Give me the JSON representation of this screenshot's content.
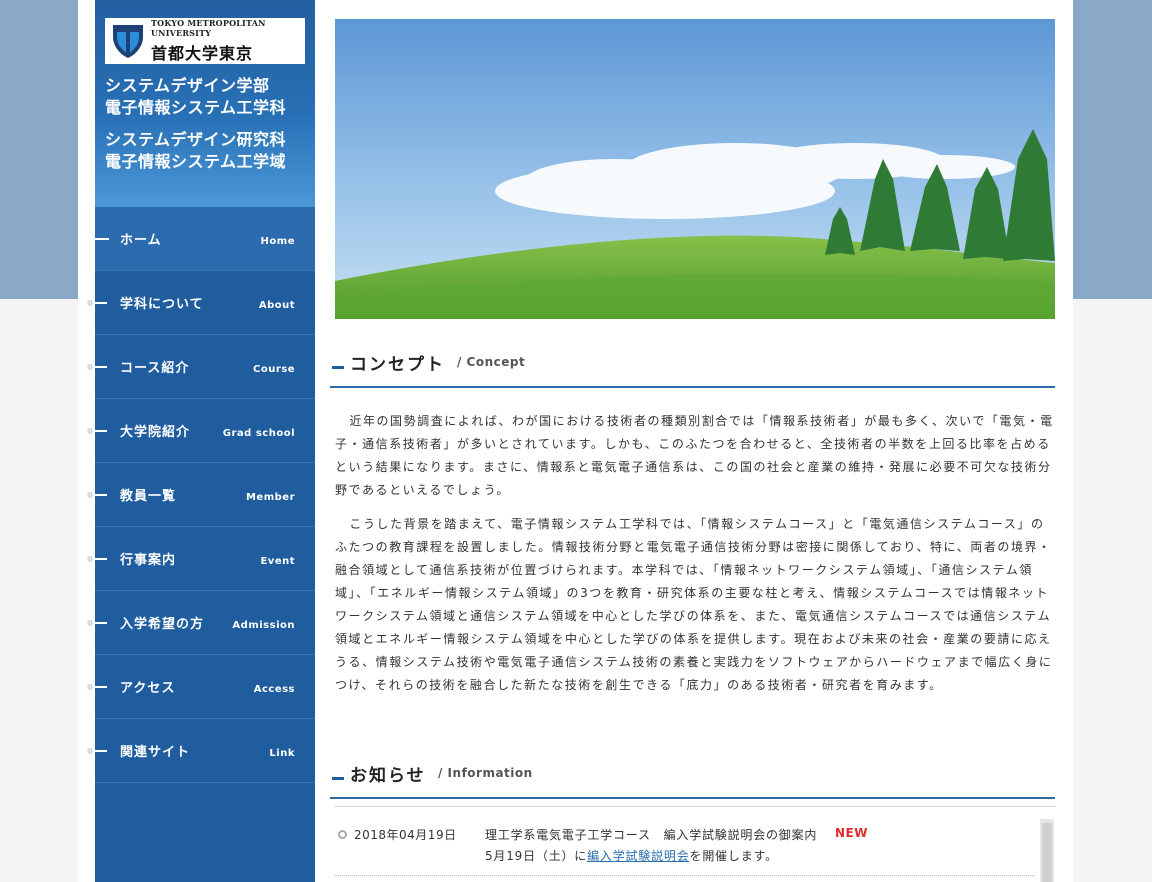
{
  "branding": {
    "university_en": "TOKYO METROPOLITAN UNIVERSITY",
    "university_ja": "首都大学東京",
    "dept_lines": [
      "システムデザイン学部",
      "電子情報システム工学科",
      "システムデザイン研究科",
      "電子情報システム工学域"
    ]
  },
  "nav": {
    "items": [
      {
        "ja": "ホーム",
        "en": "Home"
      },
      {
        "ja": "学科について",
        "en": "About"
      },
      {
        "ja": "コース紹介",
        "en": "Course"
      },
      {
        "ja": "大学院紹介",
        "en": "Grad school"
      },
      {
        "ja": "教員一覧",
        "en": "Member"
      },
      {
        "ja": "行事案内",
        "en": "Event"
      },
      {
        "ja": "入学希望の方",
        "en": "Admission"
      },
      {
        "ja": "アクセス",
        "en": "Access"
      },
      {
        "ja": "関連サイト",
        "en": "Link"
      }
    ]
  },
  "concept": {
    "title_ja": "コンセプト",
    "title_en": "/ Concept",
    "paragraphs": [
      "近年の国勢調査によれば、わが国における技術者の種類別割合では「情報系技術者」が最も多く、次いで「電気・電子・通信系技術者」が多いとされています。しかも、このふたつを合わせると、全技術者の半数を上回る比率を占めるという結果になります。まさに、情報系と電気電子通信系は、この国の社会と産業の維持・発展に必要不可欠な技術分野であるといえるでしょう。",
      "こうした背景を踏まえて、電子情報システム工学科では、「情報システムコース」と「電気通信システムコース」のふたつの教育課程を設置しました。情報技術分野と電気電子通信技術分野は密接に関係しており、特に、両者の境界・融合領域として通信系技術が位置づけられます。本学科では、「情報ネットワークシステム領域」、「通信システム領域」、「エネルギー情報システム領域」の3つを教育・研究体系の主要な柱と考え、情報システムコースでは情報ネットワークシステム領域と通信システム領域を中心とした学びの体系を、また、電気通信システムコースでは通信システム領域とエネルギー情報システム領域を中心とした学びの体系を提供します。現在および未来の社会・産業の要請に応えうる、情報システム技術や電気電子通信システム技術の素養と実践力をソフトウェアからハードウェアまで幅広く身につけ、それらの技術を融合した新たな技術を創生できる「底力」のある技術者・研究者を育みます。"
    ]
  },
  "info": {
    "title_ja": "お知らせ",
    "title_en": "/ Information",
    "news": [
      {
        "date": "2018年04月19日",
        "title": "理工学系電気電子工学コース　編入学試験説明会の御案内",
        "badge": "NEW",
        "sub_prefix": "5月19日（土）に",
        "sub_link": "編入学試験説明会",
        "sub_suffix": "を開催します。"
      }
    ]
  },
  "colors": {
    "sidebar": "#1f5d9e",
    "accent_line": "#2c6aa8",
    "top_band": "#8aa9c8",
    "new_badge": "#e02c2c"
  }
}
